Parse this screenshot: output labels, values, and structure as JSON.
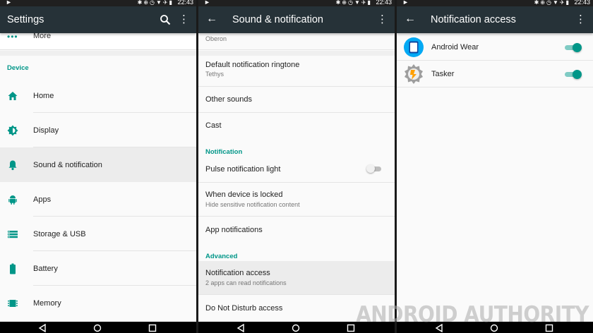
{
  "status_bar": {
    "time": "22:43"
  },
  "panel1": {
    "title": "Settings",
    "more_label": "More",
    "section": "Device",
    "items": [
      {
        "label": "Home",
        "icon": "home-icon"
      },
      {
        "label": "Display",
        "icon": "brightness-icon"
      },
      {
        "label": "Sound & notification",
        "icon": "bell-icon",
        "selected": true
      },
      {
        "label": "Apps",
        "icon": "android-icon"
      },
      {
        "label": "Storage & USB",
        "icon": "storage-icon"
      },
      {
        "label": "Battery",
        "icon": "battery-icon"
      },
      {
        "label": "Memory",
        "icon": "memory-chip-icon"
      }
    ]
  },
  "panel2": {
    "title": "Sound & notification",
    "partial_top": "Oberon",
    "ringtone": {
      "primary": "Default notification ringtone",
      "secondary": "Tethys"
    },
    "other_sounds": "Other sounds",
    "cast": "Cast",
    "section_notification": "Notification",
    "pulse_light": {
      "label": "Pulse notification light",
      "enabled": false
    },
    "locked": {
      "primary": "When device is locked",
      "secondary": "Hide sensitive notification content"
    },
    "app_notifications": "App notifications",
    "section_advanced": "Advanced",
    "notification_access": {
      "primary": "Notification access",
      "secondary": "2 apps can read notifications"
    },
    "dnd_access": "Do Not Disturb access"
  },
  "panel3": {
    "title": "Notification access",
    "apps": [
      {
        "label": "Android Wear",
        "icon": "android-wear-icon",
        "enabled": true
      },
      {
        "label": "Tasker",
        "icon": "tasker-icon",
        "enabled": true
      }
    ]
  },
  "watermark": "ANDROID AUTHORITY",
  "colors": {
    "accent": "#009688",
    "toolbar": "#263238",
    "status_bar": "#202020"
  }
}
